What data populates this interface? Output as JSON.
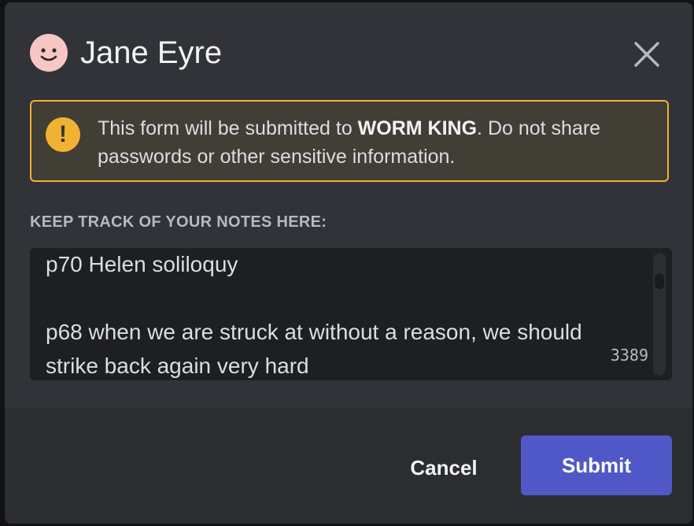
{
  "modal": {
    "title": "Jane Eyre",
    "avatar_icon": "smiley-face-icon",
    "close_icon": "close-icon"
  },
  "warning": {
    "icon": "exclamation-icon",
    "text_before": "This form will be submitted to ",
    "recipient": "WORM KING",
    "text_after": ". Do not share passwords or other sensitive information."
  },
  "notes": {
    "label": "KEEP TRACK OF YOUR NOTES HERE:",
    "value": "p70 Helen soliloquy\n\np68 when we are struck at without a reason, we should strike back again very hard",
    "remaining_chars": "3389"
  },
  "footer": {
    "cancel_label": "Cancel",
    "submit_label": "Submit"
  },
  "colors": {
    "accent": "#5058c8",
    "warning": "#f0b232",
    "background": "#313338"
  }
}
